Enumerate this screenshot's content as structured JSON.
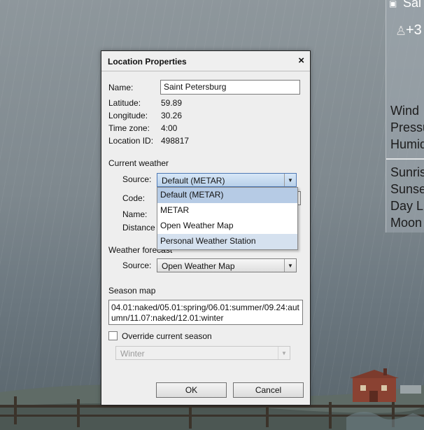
{
  "side_panel": {
    "city_fragment": "Sai",
    "temp_fragment": "+3",
    "lines": [
      "Wind",
      "Pressu",
      "Humid",
      "Sunris",
      "Sunse",
      "Day L",
      "Moon"
    ]
  },
  "dialog": {
    "title": "Location Properties",
    "close_glyph": "×",
    "name_label": "Name:",
    "name_value": "Saint Petersburg",
    "latitude_label": "Latitude:",
    "latitude_value": "59.89",
    "longitude_label": "Longitude:",
    "longitude_value": "30.26",
    "timezone_label": "Time zone:",
    "timezone_value": "4:00",
    "location_id_label": "Location ID:",
    "location_id_value": "498817",
    "current_weather": {
      "section_label": "Current weather",
      "source_label": "Source:",
      "source_value": "Default (METAR)",
      "code_label": "Code:",
      "name_label": "Name:",
      "distance_label": "Distance",
      "dropdown_options": [
        "Default (METAR)",
        "METAR",
        "Open Weather Map",
        "Personal Weather Station"
      ]
    },
    "weather_forecast": {
      "section_label": "Weather forecast",
      "source_label": "Source:",
      "source_value": "Open Weather Map"
    },
    "season_map": {
      "section_label": "Season map",
      "value": "04.01:naked/05.01:spring/06.01:summer/09.24:autumn/11.07:naked/12.01:winter"
    },
    "override": {
      "label": "Override current season",
      "checked": false,
      "season_value": "Winter"
    },
    "ok_label": "OK",
    "cancel_label": "Cancel"
  }
}
